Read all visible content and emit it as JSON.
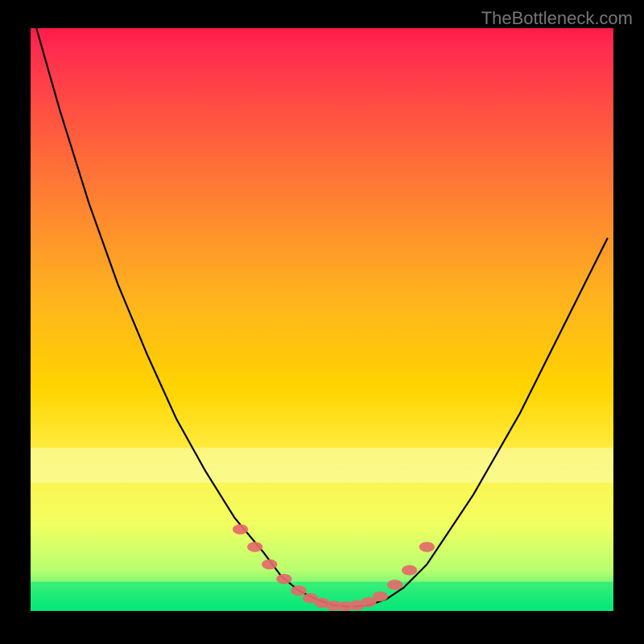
{
  "watermark": "TheBottleneck.com",
  "chart_data": {
    "type": "line",
    "title": "",
    "xlabel": "",
    "ylabel": "",
    "xlim": [
      0,
      100
    ],
    "ylim": [
      0,
      100
    ],
    "background_gradient": {
      "top": "#ff1a4a",
      "mid": "#ffd400",
      "bottom_band": "#00e77a"
    },
    "accent_bands": [
      {
        "y_from": 72,
        "y_to": 78,
        "color": "#f8ffb8"
      },
      {
        "y_from": 95,
        "y_to": 100,
        "color": "#00e77a"
      }
    ],
    "series": [
      {
        "name": "curve",
        "color": "#000000",
        "x": [
          1,
          5,
          10,
          15,
          20,
          25,
          30,
          35,
          40,
          43,
          46,
          49,
          52,
          55,
          58,
          61,
          64,
          68,
          72,
          76,
          80,
          84,
          88,
          92,
          96,
          99
        ],
        "values": [
          0,
          14,
          30,
          44,
          56,
          67,
          76,
          84,
          90,
          94,
          96.5,
          98,
          99,
          99.3,
          99,
          98,
          96,
          92,
          86,
          80,
          73,
          66,
          58,
          50,
          42,
          36
        ]
      }
    ],
    "markers": {
      "name": "highlight-dots",
      "color": "#e46a6a",
      "radius": 6,
      "x": [
        36,
        38.5,
        41,
        43.5,
        46,
        48,
        50,
        52,
        54,
        56,
        58,
        60,
        62.5,
        65,
        68
      ],
      "values": [
        86,
        89,
        92,
        94.5,
        96.5,
        97.8,
        98.6,
        99.1,
        99.2,
        99.0,
        98.5,
        97.5,
        95.5,
        93,
        89
      ]
    }
  }
}
